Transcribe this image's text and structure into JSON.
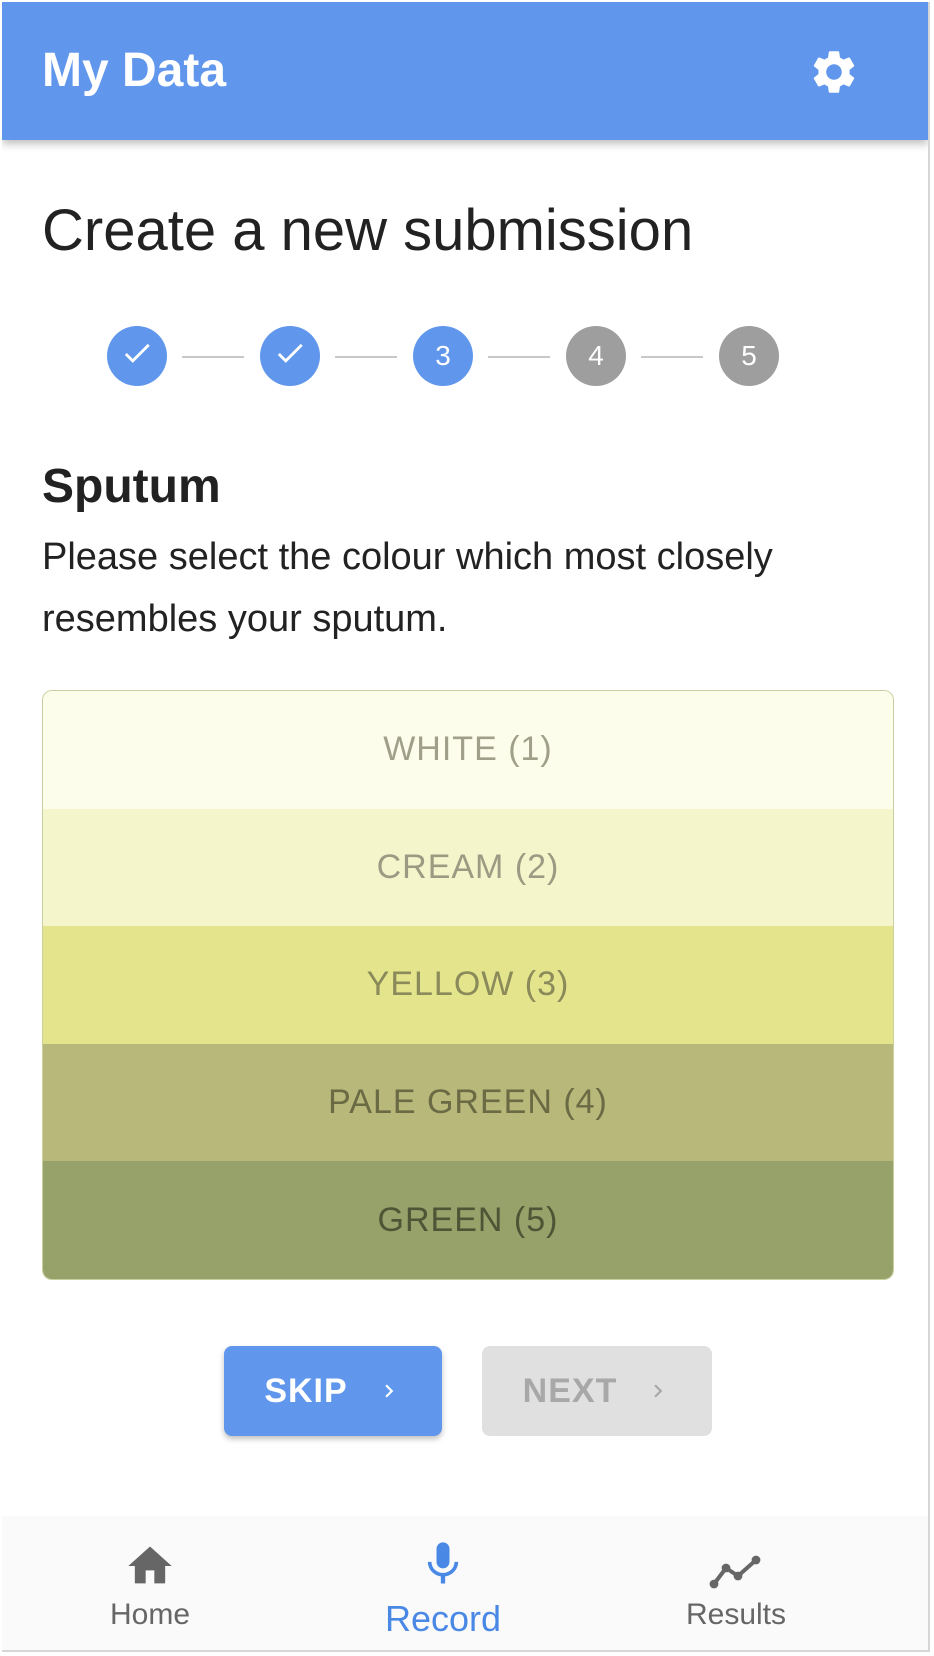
{
  "app": {
    "title": "My Data"
  },
  "page": {
    "title": "Create a new submission"
  },
  "stepper": {
    "current": 3,
    "steps": [
      {
        "state": "done",
        "label": ""
      },
      {
        "state": "done",
        "label": ""
      },
      {
        "state": "active",
        "label": "3"
      },
      {
        "state": "todo",
        "label": "4"
      },
      {
        "state": "todo",
        "label": "5"
      }
    ]
  },
  "question": {
    "title": "Sputum",
    "prompt": "Please select the colour which most closely resembles your sputum."
  },
  "options": [
    {
      "label": "WHITE (1)",
      "bg": "#fcfdea",
      "fg": "#a0a08a"
    },
    {
      "label": "CREAM (2)",
      "bg": "#f4f5cb",
      "fg": "#9b9b84"
    },
    {
      "label": "YELLOW (3)",
      "bg": "#e3e48c",
      "fg": "#8a8a5a"
    },
    {
      "label": "PALE GREEN (4)",
      "bg": "#b8b87a",
      "fg": "#6a6a44"
    },
    {
      "label": "GREEN (5)",
      "bg": "#97a26a",
      "fg": "#4e5536"
    }
  ],
  "actions": {
    "skip_label": "SKIP",
    "next_label": "NEXT"
  },
  "nav": {
    "items": [
      {
        "label": "Home",
        "icon": "home-icon",
        "active": false
      },
      {
        "label": "Record",
        "icon": "microphone-icon",
        "active": true
      },
      {
        "label": "Results",
        "icon": "chart-line-icon",
        "active": false
      }
    ]
  },
  "colors": {
    "primary": "#6097ec",
    "inactive_step": "#9e9e9e",
    "nav_active": "#4a88e6"
  }
}
